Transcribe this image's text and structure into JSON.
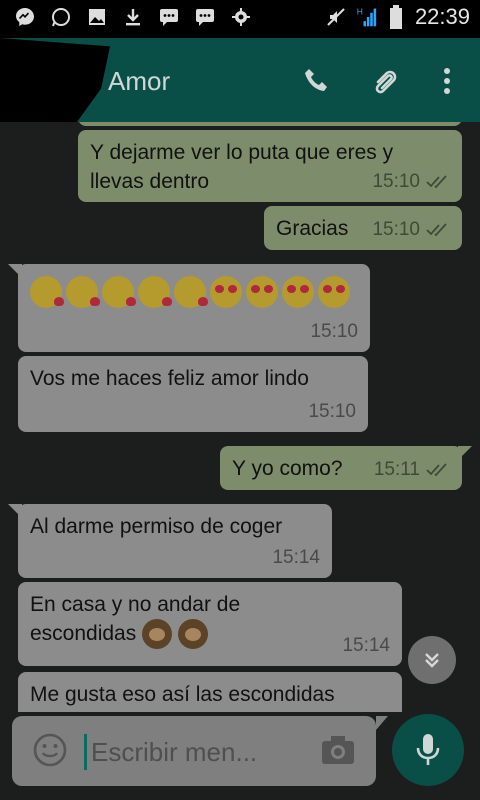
{
  "statusbar": {
    "time": "22:39",
    "network": "H"
  },
  "header": {
    "title": "Amor"
  },
  "messages": [
    {
      "text": "Y dejarme ver lo puta que eres y llevas dentro",
      "time": "15:10",
      "direction": "out"
    },
    {
      "text": "Gracias",
      "time": "15:10",
      "direction": "out"
    },
    {
      "text": "",
      "time": "15:10",
      "direction": "in",
      "emojis": [
        "kiss",
        "kiss",
        "kiss",
        "kiss",
        "kiss",
        "heart-eyes",
        "heart-eyes",
        "heart-eyes",
        "heart-eyes"
      ]
    },
    {
      "text": "Vos me haces feliz amor lindo",
      "time": "15:10",
      "direction": "in"
    },
    {
      "text": "Y yo como?",
      "time": "15:11",
      "direction": "out"
    },
    {
      "text": "Al darme permiso de coger",
      "time": "15:14",
      "direction": "in"
    },
    {
      "line1": "En casa y no andar de",
      "line2": "escondidas",
      "time": "15:14",
      "direction": "in"
    },
    {
      "text": "Me gusta eso así las escondidas",
      "direction": "in"
    }
  ],
  "composer": {
    "placeholder": "Escribir men..."
  },
  "colors": {
    "header": "#0a4f47",
    "outgoing": "#7d8d6c",
    "incoming": "#8c8c8c",
    "accent": "#0b6b60"
  }
}
